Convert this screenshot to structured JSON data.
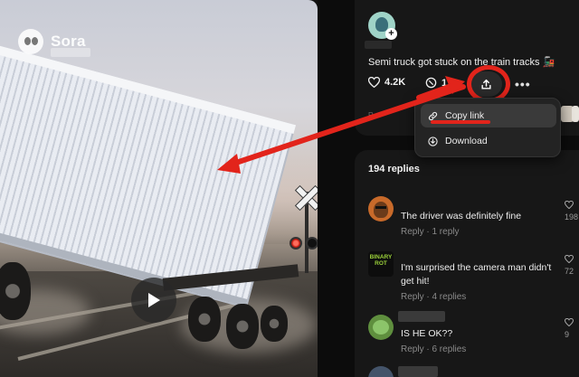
{
  "colors": {
    "annotation_red": "#e2241b",
    "panel_bg": "#171717",
    "page_bg": "#0c0c0c"
  },
  "video": {
    "brand": "Sora",
    "logo_icon": "sora-logo-icon",
    "play_icon": "play-icon"
  },
  "post": {
    "avatar_icon": "user-avatar",
    "caption": "Semi truck got stuck on the train tracks 🚂",
    "likes": "4.2K",
    "remixes": "1.",
    "share_icon": "share-upload-icon",
    "more_label": "•••"
  },
  "share_menu": {
    "items": [
      {
        "label": "Copy link",
        "icon": "link-icon",
        "highlighted": true
      },
      {
        "label": "Download",
        "icon": "download-icon",
        "highlighted": false
      }
    ]
  },
  "replies": {
    "title": "194 replies",
    "comments": [
      {
        "text": "The driver was definitely fine",
        "reply": "Reply",
        "count": "1 reply",
        "likes": "198"
      },
      {
        "text": "I'm surprised the camera man didn't get hit!",
        "reply": "Reply",
        "count": "4 replies",
        "likes": "72",
        "avatar_text": "BINARY ROT"
      },
      {
        "text": "IS HE OK??",
        "reply": "Reply",
        "count": "6 replies",
        "likes": "9"
      }
    ]
  }
}
